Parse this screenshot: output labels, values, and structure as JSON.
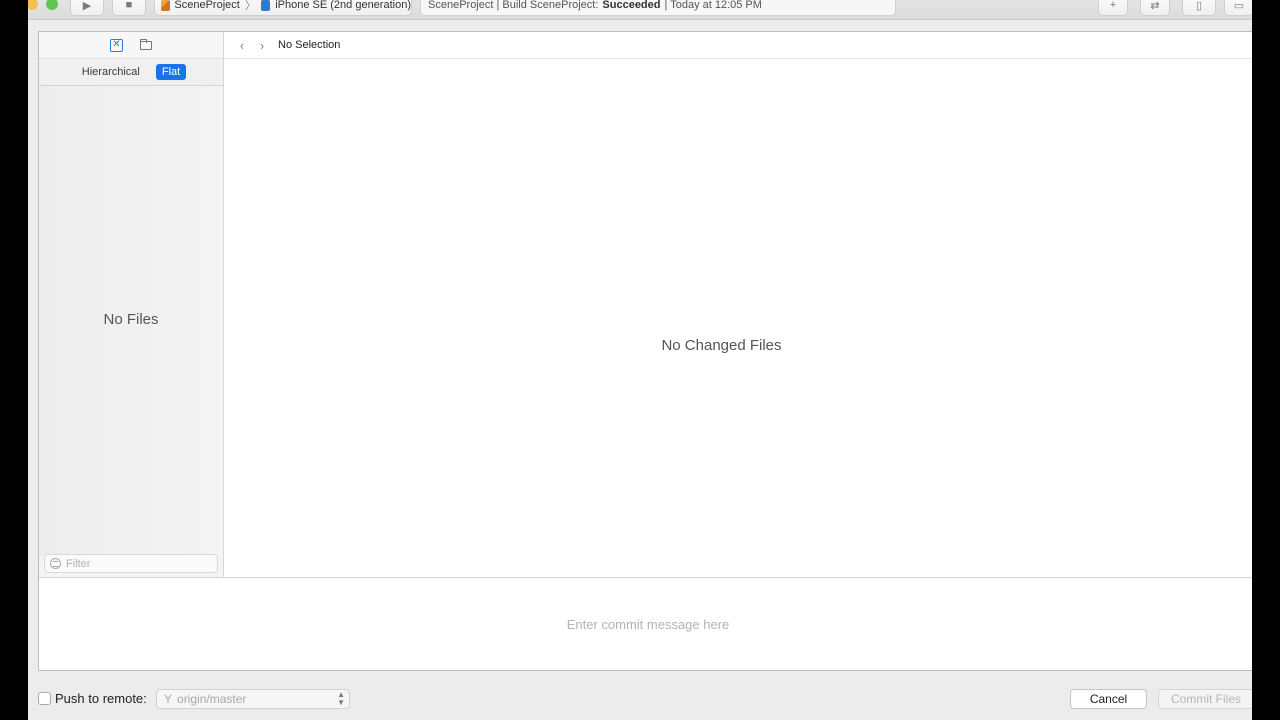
{
  "toolbar": {
    "scheme": {
      "project": "SceneProject",
      "separator": "〉",
      "device": "iPhone SE (2nd generation)"
    },
    "activity": {
      "prefix": "SceneProject | Build SceneProject:",
      "status": "Succeeded",
      "suffix": "| Today at 12:05 PM"
    }
  },
  "sidebar": {
    "view_modes": [
      "Hierarchical",
      "Flat"
    ],
    "active_view_mode": "Flat",
    "empty_text": "No Files",
    "filter_placeholder": "Filter"
  },
  "content": {
    "jumpbar_title": "No Selection",
    "empty_text": "No Changed Files"
  },
  "commit": {
    "placeholder": "Enter commit message here"
  },
  "footer": {
    "push_label": "Push to remote:",
    "push_checked": false,
    "remote_value": "origin/master",
    "cancel_label": "Cancel",
    "commit_label": "Commit Files"
  },
  "colors": {
    "accent": "#1a73e8"
  }
}
